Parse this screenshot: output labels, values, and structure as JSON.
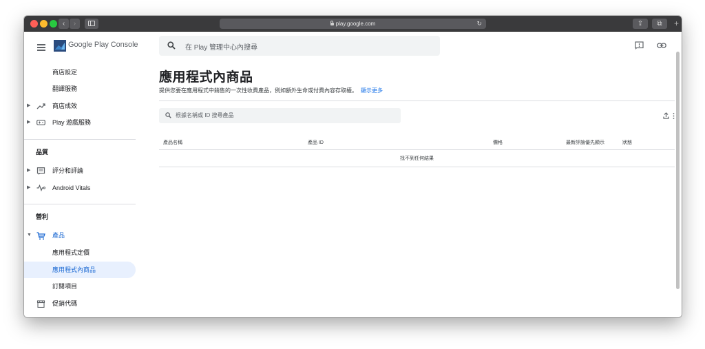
{
  "browser": {
    "url": "play.google.com",
    "nav_back": "‹",
    "nav_forward": "›",
    "reload": "↻",
    "share": "⇪",
    "tabs": "⧉",
    "new_tab": "+"
  },
  "app": {
    "brand": "Google Play Console"
  },
  "sidebar": {
    "items": [
      {
        "label": "商店設定"
      },
      {
        "label": "翻譯服務"
      },
      {
        "label": "商店成效"
      },
      {
        "label": "Play 遊戲服務"
      },
      {
        "label": "評分和評論"
      },
      {
        "label": "Android Vitals"
      },
      {
        "label": "產品"
      },
      {
        "label": "應用程式定價"
      },
      {
        "label": "應用程式內商品"
      },
      {
        "label": "訂閱項目"
      },
      {
        "label": "促銷代碼"
      }
    ],
    "sections": {
      "quality": "品質",
      "monetize": "營利"
    }
  },
  "header": {
    "search_placeholder": "在 Play 管理中心內搜尋"
  },
  "main": {
    "title": "應用程式內商品",
    "subtitle": "提供您要在應用程式中銷售的一次性收費產品，例如額外生命或付費內容存取權。",
    "learn_more": "顯示更多",
    "product_search_placeholder": "根據名稱或 ID 搜尋產品",
    "table": {
      "columns": [
        "產品名稱",
        "產品 ID",
        "價格",
        "最新評論優先顯示",
        "狀態"
      ],
      "empty_message": "找不到任何結果"
    }
  },
  "colors": {
    "accent": "#1967d2",
    "active_bg": "#e8f0fe",
    "titlebar": "#3a3a3c"
  }
}
